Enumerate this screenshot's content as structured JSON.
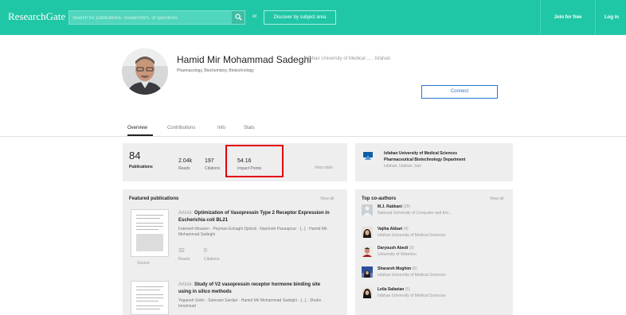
{
  "header": {
    "logo": "ResearchGate",
    "search_placeholder": "Search for publications, researchers, or questions",
    "or_text": "or",
    "discover_label": "Discover by subject area",
    "join_label": "Join for free",
    "login_label": "Log in"
  },
  "profile": {
    "name": "Hamid Mir Mohammad Sadeghi",
    "affiliation": "Isfahan University of Medical ... , Isfahan",
    "disciplines": "Pharmacology, Biochemistry, Biotechnology",
    "connect_label": "Connect"
  },
  "tabs": [
    {
      "label": "Overview"
    },
    {
      "label": "Contributions"
    },
    {
      "label": "Info"
    },
    {
      "label": "Stats"
    }
  ],
  "stats": {
    "publications": {
      "value": "84",
      "label": "Publications"
    },
    "reads": {
      "value": "2.04k",
      "label": "Reads"
    },
    "citations": {
      "value": "197",
      "label": "Citations"
    },
    "impact": {
      "value": "54.16",
      "label": "Impact Points"
    },
    "view_stats": "View stats"
  },
  "institution": {
    "name": "Isfahan University of Medical Sciences",
    "department": "Pharmaceutical Biotechnology Department",
    "location": "Isfahan, Isfahan, Iran"
  },
  "featured": {
    "title": "Featured publications",
    "view_all": "View all",
    "articles": [
      {
        "type": "Article:",
        "title": "Optimization of Vasopressin Type 2 Receptor Expression in Escherichia coli BL21",
        "authors": "Fatemeh Moazen · Peyman Eshaghi Djeboli · Nasrineh Panaapour · [...] · Hamid Mir Mohammad Sadeghi",
        "reads_value": "32",
        "reads_label": "Reads",
        "citations_value": "0",
        "citations_label": "Citations",
        "source_label": "Source"
      },
      {
        "type": "Article:",
        "title": "Study of V2 vasopressin receptor hormone binding site using in silico methods",
        "authors": "Yeganeh Sobri · Samsam Sardari · Hamid Mir Mohammad Sadeghi · [...] · Shaho Innamzad"
      }
    ]
  },
  "coauthors": {
    "title": "Top co-authors",
    "view_all": "View all",
    "list": [
      {
        "name": "M.J. Rabbani",
        "count": "(29)",
        "institution": "National University of Computer and Em..."
      },
      {
        "name": "Vajiha Akbari",
        "count": "(4)",
        "institution": "Isfahan University of Medical Sciences"
      },
      {
        "name": "Daryoush Abedi",
        "count": "(3)",
        "institution": "University of Waterloo"
      },
      {
        "name": "Sharareh Moghim",
        "count": "(6)",
        "institution": "Isfahan University of Medical Sciences"
      },
      {
        "name": "Leila Safaeian",
        "count": "(5)",
        "institution": "Isfahan University of Medical Sciences"
      }
    ]
  }
}
